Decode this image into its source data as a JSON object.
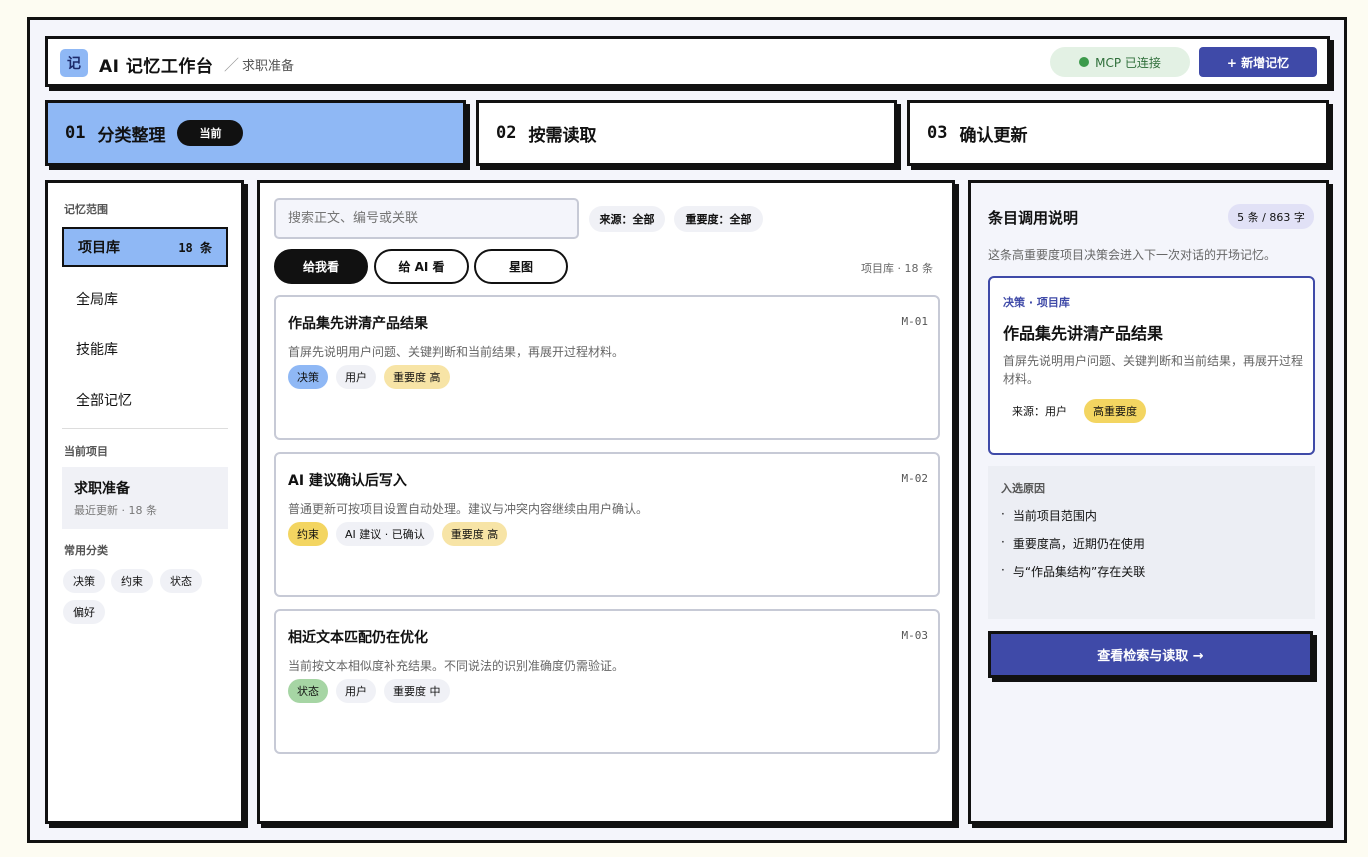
{
  "header": {
    "logo_text": "记",
    "app_title": "AI 记忆工作台",
    "breadcrumb_sep": "／",
    "breadcrumb": "求职准备",
    "mcp_status": "MCP 已连接",
    "add_button": "+ 新增记忆"
  },
  "steps": [
    {
      "num": "01",
      "label": "分类整理",
      "badge": "当前"
    },
    {
      "num": "02",
      "label": "按需读取"
    },
    {
      "num": "03",
      "label": "确认更新"
    }
  ],
  "sidebar": {
    "scope_label": "记忆范围",
    "items": [
      {
        "label": "项目库",
        "count": "18 条"
      },
      {
        "label": "全局库"
      },
      {
        "label": "技能库"
      },
      {
        "label": "全部记忆"
      }
    ],
    "current_project_label": "当前项目",
    "project": {
      "name": "求职准备",
      "meta": "最近更新 · 18 条"
    },
    "categories_label": "常用分类",
    "categories": [
      "决策",
      "约束",
      "状态",
      "偏好"
    ]
  },
  "main": {
    "search_placeholder": "搜索正文、编号或关联",
    "filters": [
      "来源：全部",
      "重要度：全部"
    ],
    "views": [
      "给我看",
      "给 AI 看",
      "星图"
    ],
    "list_meta": "项目库 · 18 条",
    "cards": [
      {
        "title": "作品集先讲清产品结果",
        "id": "M-01",
        "desc": "首屏先说明用户问题、关键判断和当前结果，再展开过程材料。",
        "tags": [
          "决策",
          "用户",
          "重要度 高"
        ]
      },
      {
        "title": "AI 建议确认后写入",
        "id": "M-02",
        "desc": "普通更新可按项目设置自动处理。建议与冲突内容继续由用户确认。",
        "tags": [
          "约束",
          "AI 建议 · 已确认",
          "重要度 高"
        ]
      },
      {
        "title": "相近文本匹配仍在优化",
        "id": "M-03",
        "desc": "当前按文本相似度补充结果。不同说法的识别准确度仍需验证。",
        "tags": [
          "状态",
          "用户",
          "重要度 中"
        ]
      }
    ]
  },
  "detail": {
    "title": "条目调用说明",
    "count": "5 条 / 863 字",
    "desc": "这条高重要度项目决策会进入下一次对话的开场记忆。",
    "card": {
      "crumb": "决策 · 项目库",
      "title": "作品集先讲清产品结果",
      "desc": "首屏先说明用户问题、关键判断和当前结果，再展开过程材料。",
      "tags": [
        "来源：用户",
        "高重要度"
      ]
    },
    "reason_label": "入选原因",
    "reasons": [
      "当前项目范围内",
      "重要度高，近期仍在使用",
      "与“作品集结构”存在关联"
    ],
    "bullet": "·",
    "action": "查看检索与读取 →"
  },
  "colors": {
    "accent_blue": "#8fb8f5",
    "primary": "#3f4aa8",
    "mcp_green": "#3c9a4b",
    "tag_yellow": "#f3d561",
    "tag_green": "#a6d5a4"
  }
}
